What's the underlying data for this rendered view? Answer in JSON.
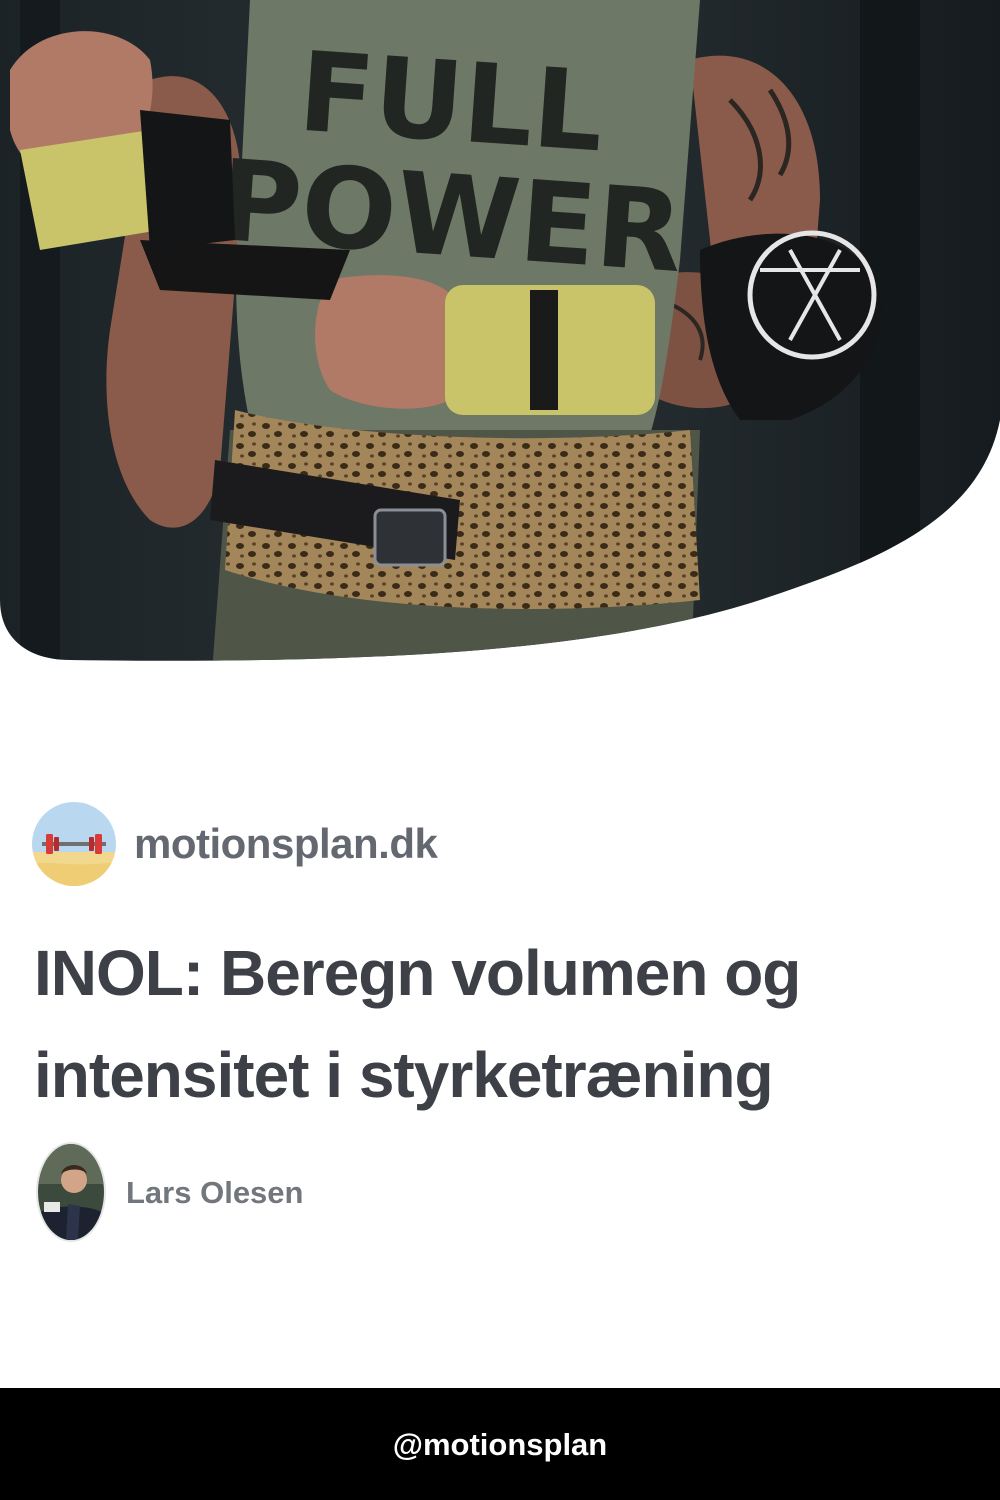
{
  "hero": {
    "shirt_line1": "FULL",
    "shirt_line2": "POWER"
  },
  "site": {
    "name": "motionsplan.dk",
    "logo_icon": "barbell-icon"
  },
  "article": {
    "title": "INOL: Beregn volumen og intensitet i styrketræning"
  },
  "author": {
    "name": "Lars Olesen",
    "avatar_icon": "person-avatar"
  },
  "footer": {
    "handle": "@motionsplan"
  },
  "colors": {
    "title": "#3d4046",
    "site_name": "#646870",
    "author_name": "#72767d",
    "footer_bg": "#000000",
    "footer_text": "#ffffff"
  }
}
